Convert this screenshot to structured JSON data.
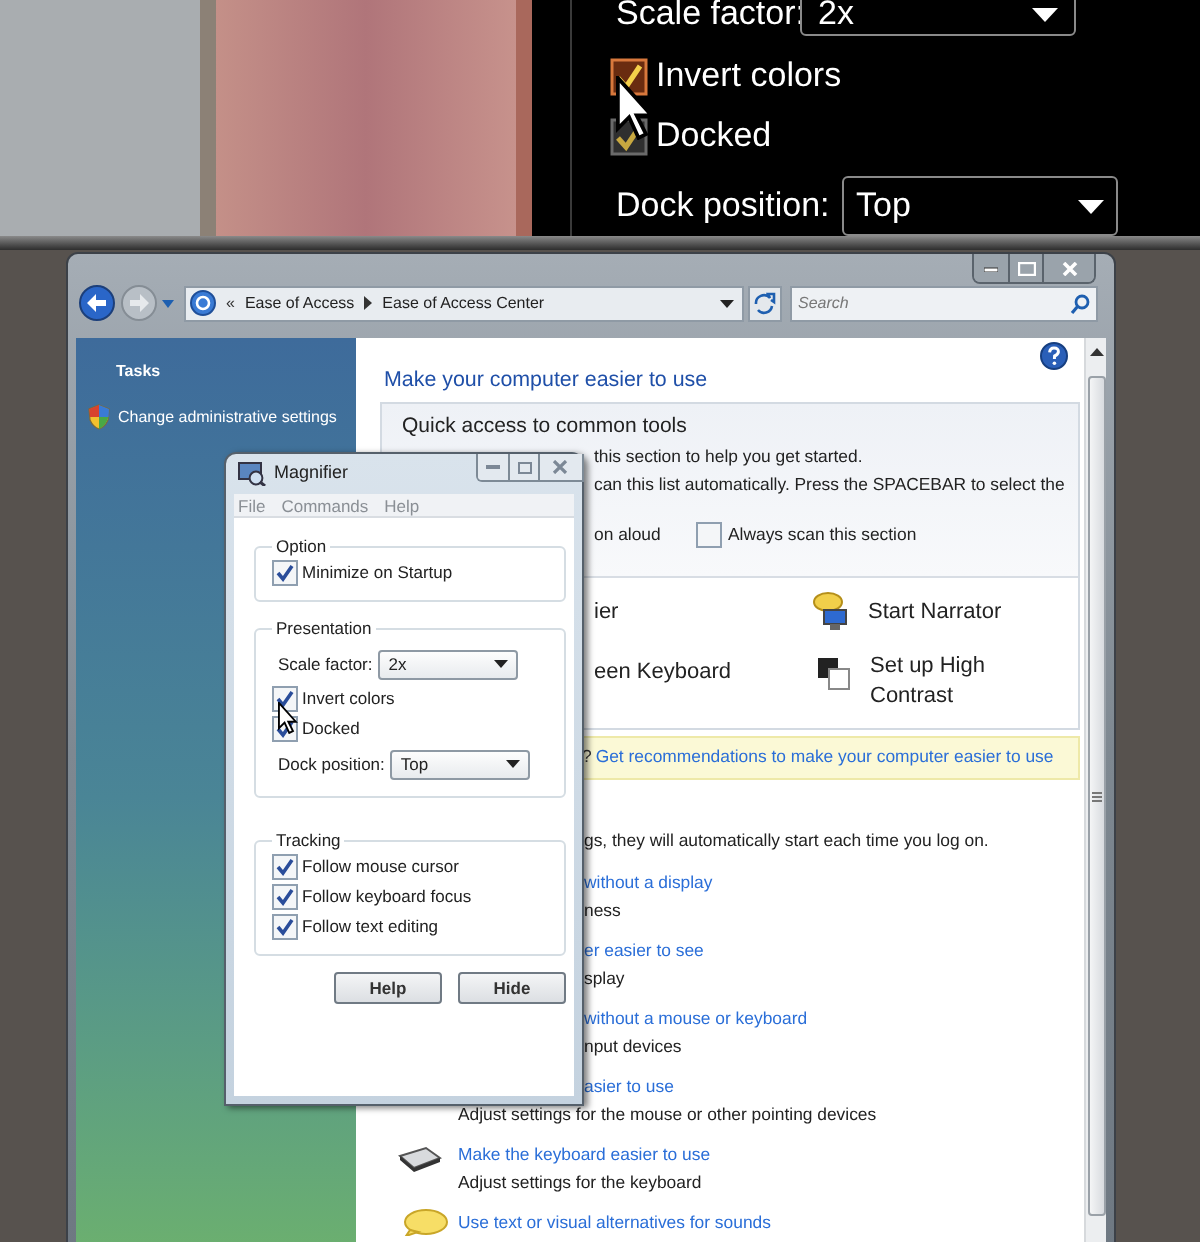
{
  "magnified_view": {
    "scale_factor_label": "Scale factor:",
    "scale_factor": "2x",
    "checkboxes": [
      {
        "label": "Invert colors",
        "checked": true,
        "hovered": true
      },
      {
        "label": "Docked",
        "checked": true,
        "hovered": false
      }
    ],
    "dock_position_label": "Dock position:",
    "dock_position": "Top"
  },
  "explorer": {
    "breadcrumb_overflow": "«",
    "breadcrumb": [
      "Ease of Access",
      "Ease of Access Center"
    ],
    "search": {
      "placeholder": "Search"
    },
    "tasks_title": "Tasks",
    "tasks": [
      {
        "label": "Change administrative settings"
      }
    ],
    "heading": "Make your computer easier to use",
    "quick_access": {
      "title": "Quick access to common tools",
      "lines": [
        "this section to help you get started.",
        "can this list automatically.  Press the SPACEBAR to select the"
      ],
      "read_aloud": "on aloud",
      "scan_option": {
        "label": "Always scan this section",
        "checked": false
      },
      "tools": [
        {
          "label": "ier",
          "kind": "covered"
        },
        {
          "label": "Start Narrator",
          "kind": "narrator"
        },
        {
          "label": "een Keyboard",
          "kind": "covered"
        },
        {
          "label": "Set up High Contrast",
          "kind": "contrast"
        }
      ]
    },
    "recommendation": {
      "prefix": "?",
      "link": "Get recommendations to make your computer easier to use"
    },
    "intro": "gs, they will automatically start each time you log on.",
    "items": [
      {
        "kind": "covered",
        "link": "without a display",
        "description": "ness"
      },
      {
        "kind": "covered",
        "link": "er easier to see",
        "description": "splay"
      },
      {
        "kind": "covered",
        "link": "without a mouse or keyboard",
        "description": "nput devices"
      },
      {
        "kind": "covered_link",
        "link": "asier to use",
        "description": "Adjust settings for the mouse or other pointing devices"
      },
      {
        "kind": "keyboard",
        "link": "Make the keyboard easier to use",
        "description": "Adjust settings for the keyboard"
      },
      {
        "kind": "speech",
        "link": "Use text or visual alternatives for sounds"
      }
    ]
  },
  "magnifier_window": {
    "title": "Magnifier",
    "menu": [
      "File",
      "Commands",
      "Help"
    ],
    "groups": [
      {
        "title": "Option",
        "rows": [
          {
            "kind": "checkbox",
            "label": "Minimize on Startup",
            "checked": true
          }
        ]
      },
      {
        "title": "Presentation",
        "rows": [
          {
            "kind": "dropdown",
            "label": "Scale factor:",
            "value": "2x"
          },
          {
            "kind": "checkbox",
            "label": "Invert colors",
            "checked": true
          },
          {
            "kind": "checkbox",
            "label": "Docked",
            "checked": true
          },
          {
            "kind": "dropdown",
            "label": "Dock position:",
            "value": "Top"
          }
        ]
      },
      {
        "title": "Tracking",
        "rows": [
          {
            "kind": "checkbox",
            "label": "Follow mouse cursor",
            "checked": true
          },
          {
            "kind": "checkbox",
            "label": "Follow keyboard focus",
            "checked": true
          },
          {
            "kind": "checkbox",
            "label": "Follow text editing",
            "checked": true
          }
        ]
      }
    ],
    "buttons": [
      "Help",
      "Hide"
    ]
  }
}
